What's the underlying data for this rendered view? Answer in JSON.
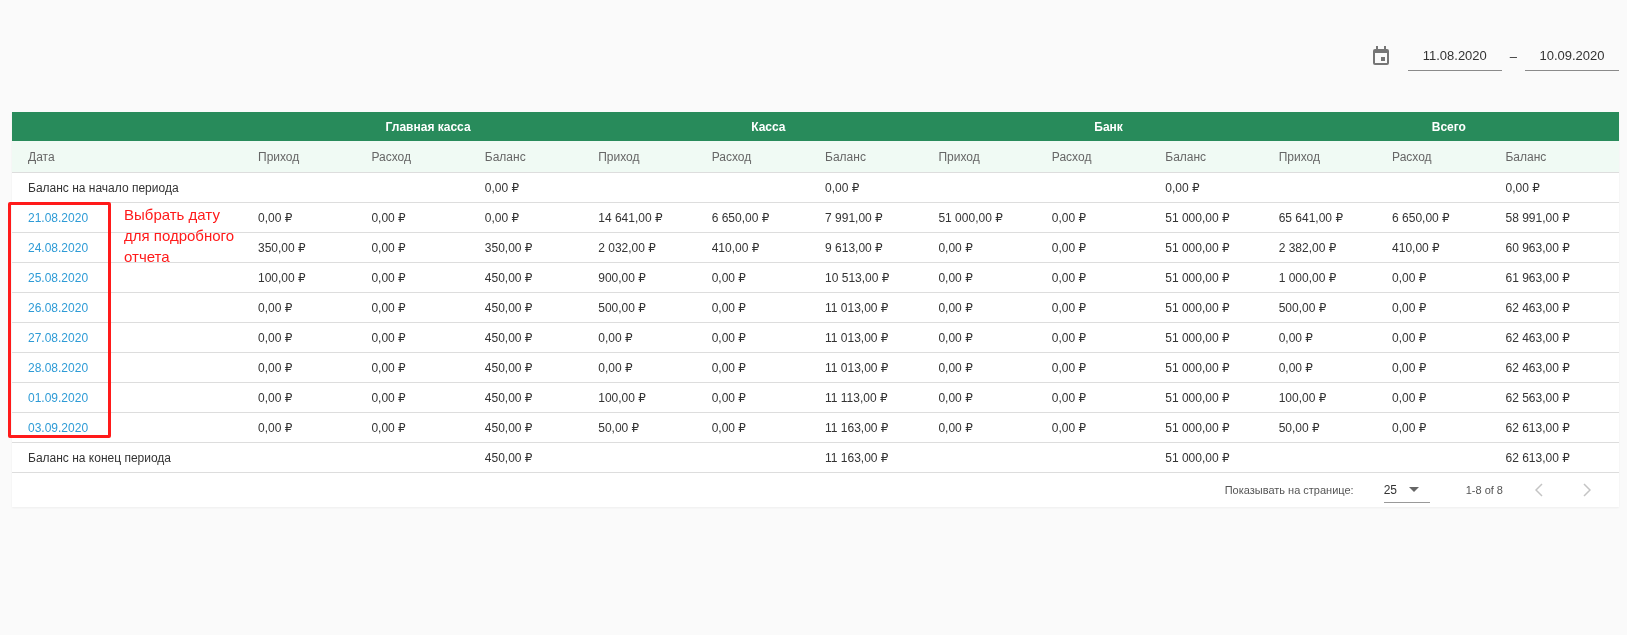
{
  "date_range": {
    "start": "11.08.2020",
    "separator": "–",
    "end": "10.09.2020"
  },
  "table": {
    "groups": [
      "Главная касса",
      "Касса",
      "Банк",
      "Всего"
    ],
    "columns": [
      "Дата",
      "Приход",
      "Расход",
      "Баланс",
      "Приход",
      "Расход",
      "Баланс",
      "Приход",
      "Расход",
      "Баланс",
      "Приход",
      "Расход",
      "Баланс"
    ],
    "rows": [
      {
        "kind": "summary",
        "cells": [
          "Баланс на начало периода",
          null,
          null,
          "0,00 ₽",
          null,
          null,
          "0,00 ₽",
          null,
          null,
          "0,00 ₽",
          null,
          null,
          "0,00 ₽"
        ]
      },
      {
        "kind": "date",
        "cells": [
          "21.08.2020",
          "0,00 ₽",
          "0,00 ₽",
          "0,00 ₽",
          "14 641,00 ₽",
          "6 650,00 ₽",
          "7 991,00 ₽",
          "51 000,00 ₽",
          "0,00 ₽",
          "51 000,00 ₽",
          "65 641,00 ₽",
          "6 650,00 ₽",
          "58 991,00 ₽"
        ]
      },
      {
        "kind": "date",
        "cells": [
          "24.08.2020",
          "350,00 ₽",
          "0,00 ₽",
          "350,00 ₽",
          "2 032,00 ₽",
          "410,00 ₽",
          "9 613,00 ₽",
          "0,00 ₽",
          "0,00 ₽",
          "51 000,00 ₽",
          "2 382,00 ₽",
          "410,00 ₽",
          "60 963,00 ₽"
        ]
      },
      {
        "kind": "date",
        "cells": [
          "25.08.2020",
          "100,00 ₽",
          "0,00 ₽",
          "450,00 ₽",
          "900,00 ₽",
          "0,00 ₽",
          "10 513,00 ₽",
          "0,00 ₽",
          "0,00 ₽",
          "51 000,00 ₽",
          "1 000,00 ₽",
          "0,00 ₽",
          "61 963,00 ₽"
        ]
      },
      {
        "kind": "date",
        "cells": [
          "26.08.2020",
          "0,00 ₽",
          "0,00 ₽",
          "450,00 ₽",
          "500,00 ₽",
          "0,00 ₽",
          "11 013,00 ₽",
          "0,00 ₽",
          "0,00 ₽",
          "51 000,00 ₽",
          "500,00 ₽",
          "0,00 ₽",
          "62 463,00 ₽"
        ]
      },
      {
        "kind": "date",
        "cells": [
          "27.08.2020",
          "0,00 ₽",
          "0,00 ₽",
          "450,00 ₽",
          "0,00 ₽",
          "0,00 ₽",
          "11 013,00 ₽",
          "0,00 ₽",
          "0,00 ₽",
          "51 000,00 ₽",
          "0,00 ₽",
          "0,00 ₽",
          "62 463,00 ₽"
        ]
      },
      {
        "kind": "date",
        "cells": [
          "28.08.2020",
          "0,00 ₽",
          "0,00 ₽",
          "450,00 ₽",
          "0,00 ₽",
          "0,00 ₽",
          "11 013,00 ₽",
          "0,00 ₽",
          "0,00 ₽",
          "51 000,00 ₽",
          "0,00 ₽",
          "0,00 ₽",
          "62 463,00 ₽"
        ]
      },
      {
        "kind": "date",
        "cells": [
          "01.09.2020",
          "0,00 ₽",
          "0,00 ₽",
          "450,00 ₽",
          "100,00 ₽",
          "0,00 ₽",
          "11 113,00 ₽",
          "0,00 ₽",
          "0,00 ₽",
          "51 000,00 ₽",
          "100,00 ₽",
          "0,00 ₽",
          "62 563,00 ₽"
        ]
      },
      {
        "kind": "date",
        "cells": [
          "03.09.2020",
          "0,00 ₽",
          "0,00 ₽",
          "450,00 ₽",
          "50,00 ₽",
          "0,00 ₽",
          "11 163,00 ₽",
          "0,00 ₽",
          "0,00 ₽",
          "51 000,00 ₽",
          "50,00 ₽",
          "0,00 ₽",
          "62 613,00 ₽"
        ]
      },
      {
        "kind": "summary",
        "cells": [
          "Баланс на конец периода",
          null,
          null,
          "450,00 ₽",
          null,
          null,
          "11 163,00 ₽",
          null,
          null,
          "51 000,00 ₽",
          null,
          null,
          "62 613,00 ₽"
        ]
      }
    ]
  },
  "pagination": {
    "rows_label": "Показывать на странице:",
    "rows_per_page": "25",
    "range": "1-8 of 8",
    "prev_disabled": true,
    "next_disabled": true
  },
  "annotation": {
    "text": "Выбрать дату для подробного отчета"
  }
}
